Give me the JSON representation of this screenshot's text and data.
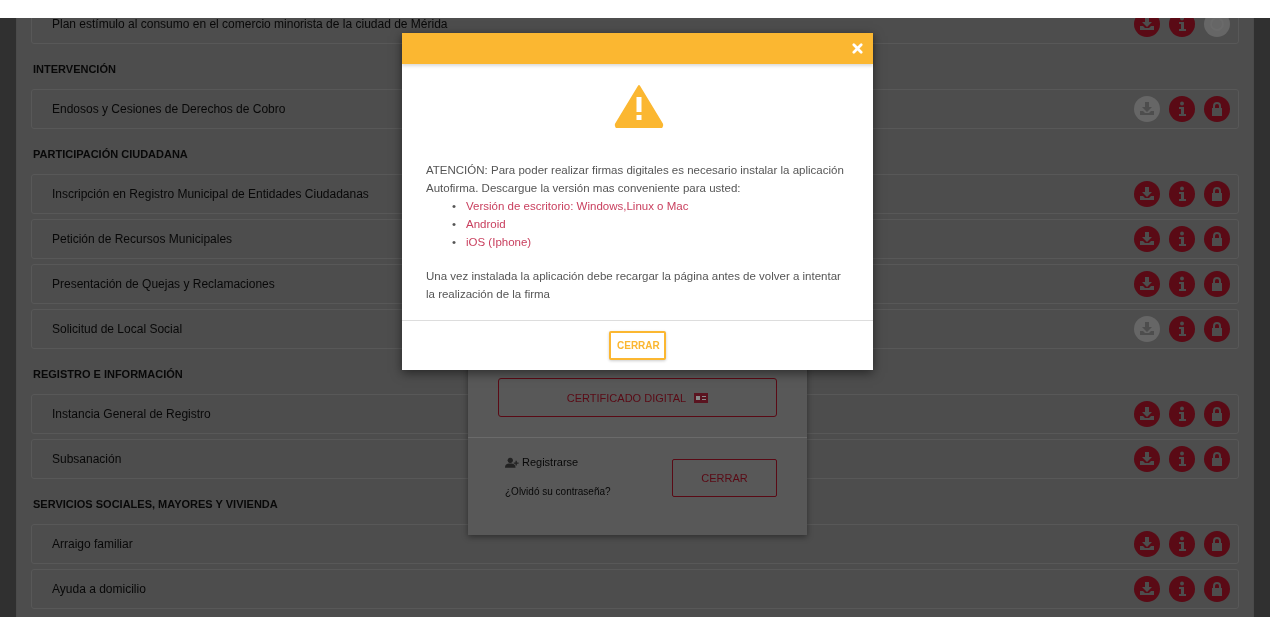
{
  "sections": [
    {
      "items": [
        {
          "label": "Plan estímulo al consumo en el comercio minorista de la ciudad de Mérida",
          "icons": [
            {
              "kind": "download",
              "enabled": true
            },
            {
              "kind": "info",
              "enabled": true
            },
            {
              "kind": "clock",
              "enabled": false
            }
          ]
        }
      ]
    },
    {
      "title": "INTERVENCIÓN",
      "items": [
        {
          "label": "Endosos y Cesiones de Derechos de Cobro",
          "icons": [
            {
              "kind": "download",
              "enabled": false
            },
            {
              "kind": "info",
              "enabled": true
            },
            {
              "kind": "lock",
              "enabled": true
            }
          ]
        }
      ]
    },
    {
      "title": "PARTICIPACIÓN CIUDADANA",
      "items": [
        {
          "label": "Inscripción en Registro Municipal de Entidades Ciudadanas",
          "icons": [
            {
              "kind": "download",
              "enabled": true
            },
            {
              "kind": "info",
              "enabled": true
            },
            {
              "kind": "lock",
              "enabled": true
            }
          ]
        },
        {
          "label": "Petición de Recursos Municipales",
          "icons": [
            {
              "kind": "download",
              "enabled": true
            },
            {
              "kind": "info",
              "enabled": true
            },
            {
              "kind": "lock",
              "enabled": true
            }
          ]
        },
        {
          "label": "Presentación de Quejas y Reclamaciones",
          "icons": [
            {
              "kind": "download",
              "enabled": true
            },
            {
              "kind": "info",
              "enabled": true
            },
            {
              "kind": "lock",
              "enabled": true
            }
          ]
        },
        {
          "label": "Solicitud de Local Social",
          "icons": [
            {
              "kind": "download",
              "enabled": false
            },
            {
              "kind": "info",
              "enabled": true
            },
            {
              "kind": "lock",
              "enabled": true
            }
          ]
        }
      ]
    },
    {
      "title": "REGISTRO E INFORMACIÓN",
      "items": [
        {
          "label": "Instancia General de Registro",
          "icons": [
            {
              "kind": "download",
              "enabled": true
            },
            {
              "kind": "info",
              "enabled": true
            },
            {
              "kind": "lock",
              "enabled": true
            }
          ]
        },
        {
          "label": "Subsanación",
          "icons": [
            {
              "kind": "download",
              "enabled": true
            },
            {
              "kind": "info",
              "enabled": true
            },
            {
              "kind": "lock",
              "enabled": true
            }
          ]
        }
      ]
    },
    {
      "title": "SERVICIOS SOCIALES, MAYORES Y VIVIENDA",
      "items": [
        {
          "label": "Arraigo familiar",
          "icons": [
            {
              "kind": "download",
              "enabled": true
            },
            {
              "kind": "info",
              "enabled": true
            },
            {
              "kind": "lock",
              "enabled": true
            }
          ]
        },
        {
          "label": "Ayuda a domicilio",
          "icons": [
            {
              "kind": "download",
              "enabled": true
            },
            {
              "kind": "info",
              "enabled": true
            },
            {
              "kind": "lock",
              "enabled": true
            }
          ]
        }
      ]
    }
  ],
  "login_dialog": {
    "certificate_button": "CERTIFICADO DIGITAL",
    "register_link": "Registrarse",
    "forgot_link": "¿Olvidó su contraseña?",
    "close_button": "CERRAR"
  },
  "warning_dialog": {
    "message": "ATENCIÓN: Para poder realizar firmas digitales es necesario instalar la aplicación Autofirma. Descargue la versión mas conveniente para usted:",
    "links": [
      {
        "bullet": "•",
        "text": "Versión de escritorio: Windows,Linux o Mac"
      },
      {
        "bullet": "•",
        "text": "Android"
      },
      {
        "bullet": "•",
        "text": "iOS (Iphone)"
      }
    ],
    "note": "Una vez instalada la aplicación debe recargar la página antes de volver a intentar la realización de la firma",
    "close_button": "CERRAR"
  }
}
